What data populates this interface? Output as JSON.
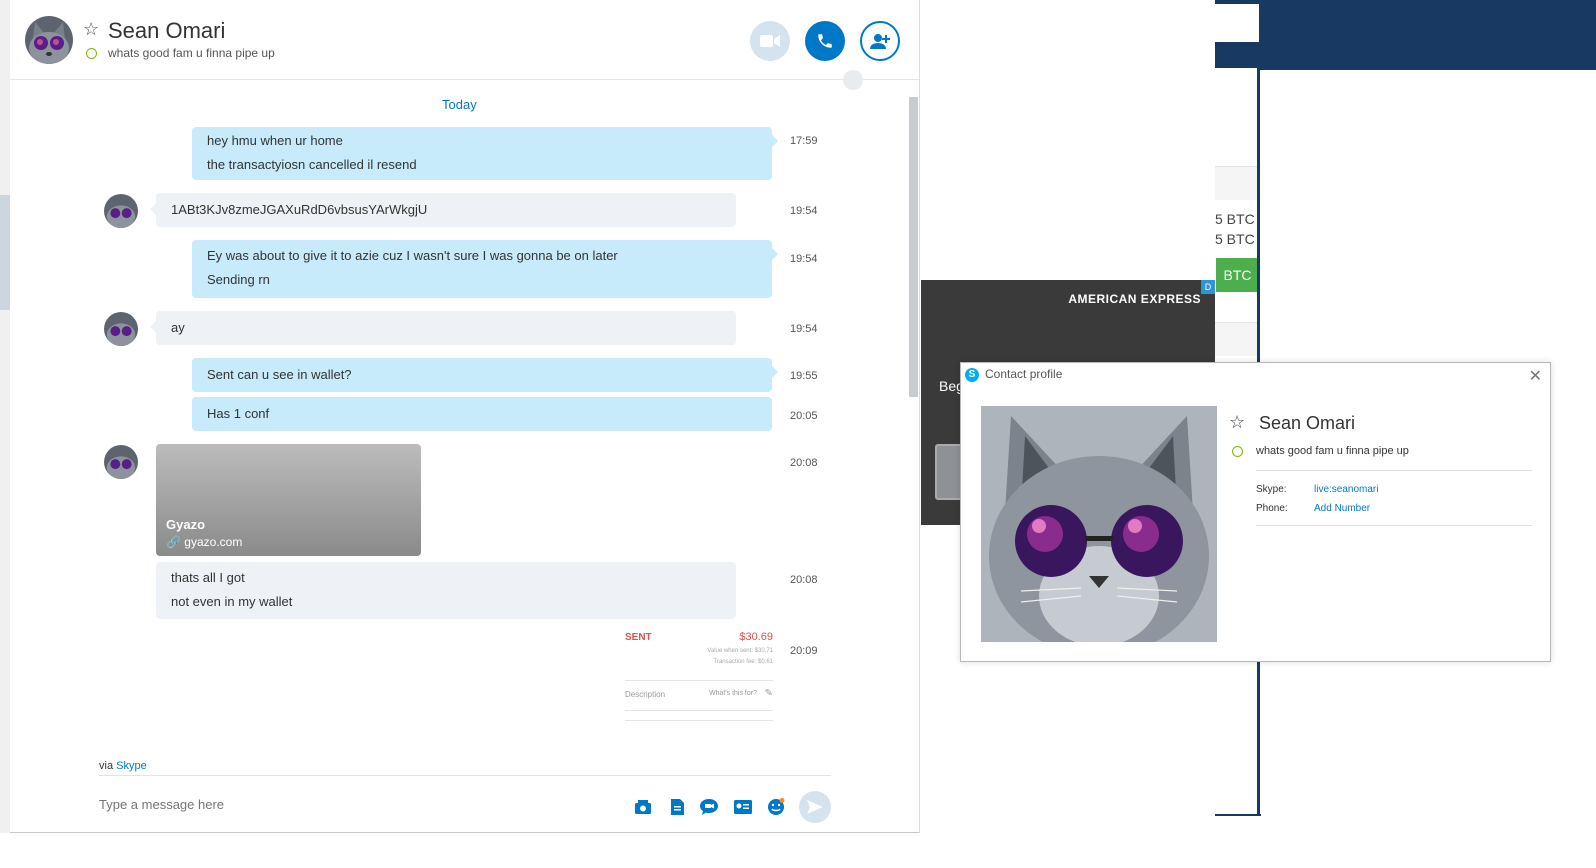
{
  "conversation": {
    "contact_name": "Sean Omari",
    "mood": "whats good fam u finna pipe up",
    "header_icons": [
      "video-call-icon",
      "voice-call-icon",
      "add-people-icon"
    ],
    "date_divider": "Today"
  },
  "messages": [
    {
      "direction": "out",
      "lines": [
        "hey hmu when ur home",
        "the transactyiosn cancelled il resend"
      ],
      "time": "17:59"
    },
    {
      "direction": "in",
      "lines": [
        "1ABt3KJv8zmeJGAXuRdD6vbsusYArWkgjU"
      ],
      "time": "19:54"
    },
    {
      "direction": "out",
      "lines": [
        "Ey was about to give it to azie cuz I wasn't sure I was gonna be on later",
        "Sending rn"
      ],
      "time": "19:54"
    },
    {
      "direction": "in",
      "lines": [
        "ay"
      ],
      "time": "19:54"
    },
    {
      "direction": "out",
      "lines": [
        "Sent can u see in wallet?"
      ],
      "time": "19:55"
    },
    {
      "direction": "out",
      "lines": [
        "Has 1 conf"
      ],
      "time": "20:05"
    },
    {
      "direction": "in",
      "type": "link",
      "title": "Gyazo",
      "url": "gyazo.com",
      "time": "20:08"
    },
    {
      "direction": "in",
      "lines": [
        "thats all I got",
        "not even in my wallet"
      ],
      "time": "20:08"
    },
    {
      "direction": "out",
      "type": "payment",
      "status": "SENT",
      "amount": "$30.69",
      "value_when_sent": "Value when sent: $30.71",
      "fee": "Transaction fee: $0.61",
      "description_label": "Description",
      "description_placeholder": "What's this for?",
      "time": "20:09"
    }
  ],
  "footer": {
    "via_prefix": "via",
    "via_link": "Skype",
    "compose_placeholder": "Type a message here",
    "tool_icons": [
      "send-photo-icon",
      "send-file-icon",
      "video-message-icon",
      "send-contact-icon",
      "emoticon-icon",
      "send-icon"
    ]
  },
  "background_page": {
    "btc_lines": [
      "5 BTC",
      "5 BTC"
    ],
    "btc_button": "BTC"
  },
  "ad": {
    "brand": "AMERICAN EXPRESS",
    "text": "Beg",
    "badge": "D"
  },
  "profile_popup": {
    "title": "Contact profile",
    "name": "Sean Omari",
    "mood": "whats good fam u finna pipe up",
    "skype_label": "Skype:",
    "skype_value": "live:seanomari",
    "phone_label": "Phone:",
    "phone_value": "Add Number"
  },
  "colors": {
    "accent": "#0078c8",
    "outgoing_bubble": "#c7ebfa",
    "incoming_bubble": "#eef1f5",
    "online": "#7fba00",
    "payment_sent": "#d9534f",
    "bg_header": "#183a62",
    "btc_button": "#4cae4c"
  }
}
